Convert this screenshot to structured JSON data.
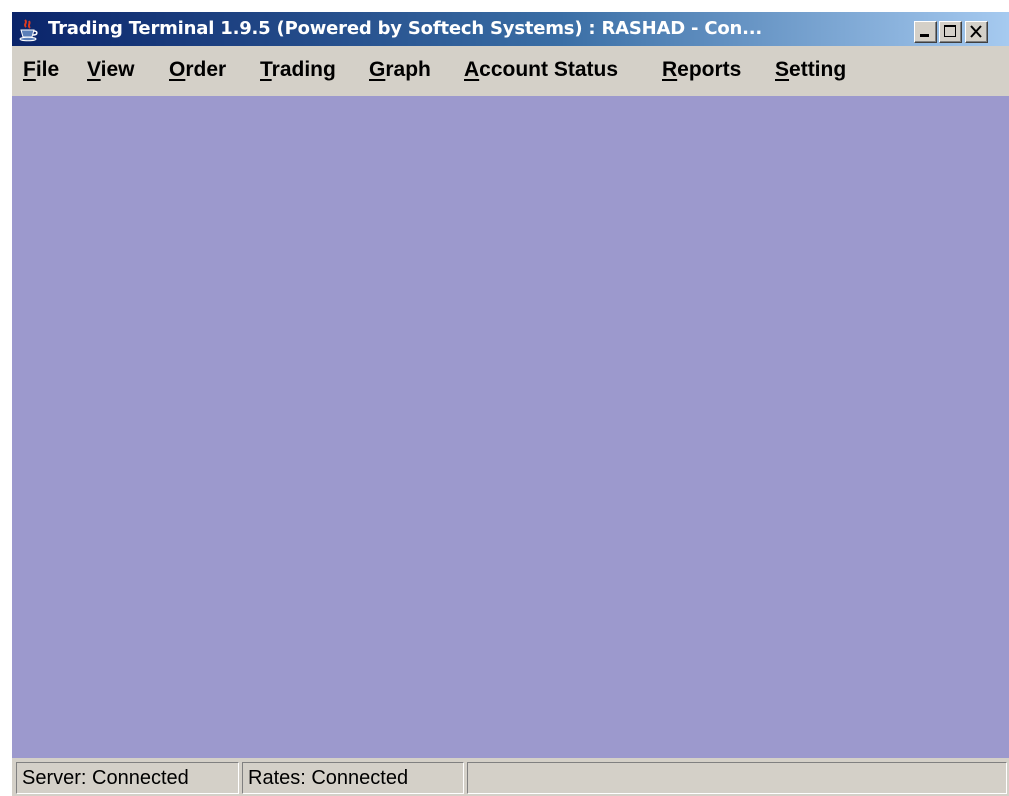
{
  "window": {
    "title": "Trading Terminal 1.9.5 (Powered by Softech Systems)   :   RASHAD - Con...",
    "icon": "java-cup-icon"
  },
  "menu": {
    "items": [
      {
        "first": "F",
        "rest": "ile"
      },
      {
        "first": "V",
        "rest": "iew"
      },
      {
        "first": "O",
        "rest": "rder"
      },
      {
        "first": "T",
        "rest": "rading"
      },
      {
        "first": "G",
        "rest": "raph"
      },
      {
        "first": "A",
        "rest": "ccount Status"
      },
      {
        "first": "R",
        "rest": "eports"
      },
      {
        "first": "S",
        "rest": "etting"
      }
    ]
  },
  "status": {
    "server": "Server: Connected",
    "rates": "Rates: Connected",
    "extra": ""
  },
  "colors": {
    "desktop": "#9c99cd",
    "chrome": "#d4d0c8",
    "titlebar_start": "#0a246a",
    "titlebar_end": "#a6caf0"
  }
}
